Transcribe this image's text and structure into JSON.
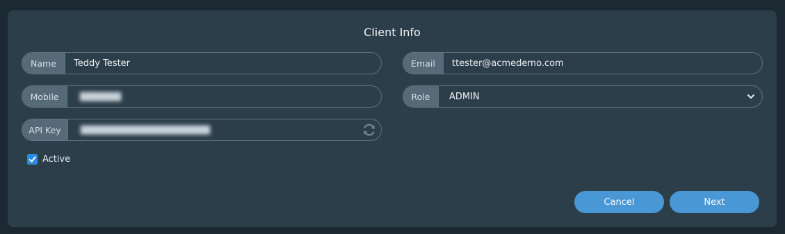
{
  "dialog": {
    "title": "Client Info"
  },
  "fields": {
    "name": {
      "label": "Name",
      "value": "Teddy Tester"
    },
    "email": {
      "label": "Email",
      "value": "ttester@acmedemo.com"
    },
    "mobile": {
      "label": "Mobile",
      "value": ""
    },
    "role": {
      "label": "Role",
      "value": "ADMIN",
      "options": [
        "ADMIN"
      ]
    },
    "api_key": {
      "label": "API Key",
      "value": ""
    }
  },
  "active": {
    "label": "Active",
    "checked": true
  },
  "buttons": {
    "cancel": "Cancel",
    "next": "Next"
  },
  "colors": {
    "background": "#1c2932",
    "panel": "#2c3e4a",
    "label_bg": "#566a77",
    "accent": "#4a97d6",
    "checkbox": "#2f8ae6"
  },
  "icons": {
    "refresh": "refresh-icon",
    "chevron": "chevron-down-icon",
    "check": "checkmark-icon"
  }
}
